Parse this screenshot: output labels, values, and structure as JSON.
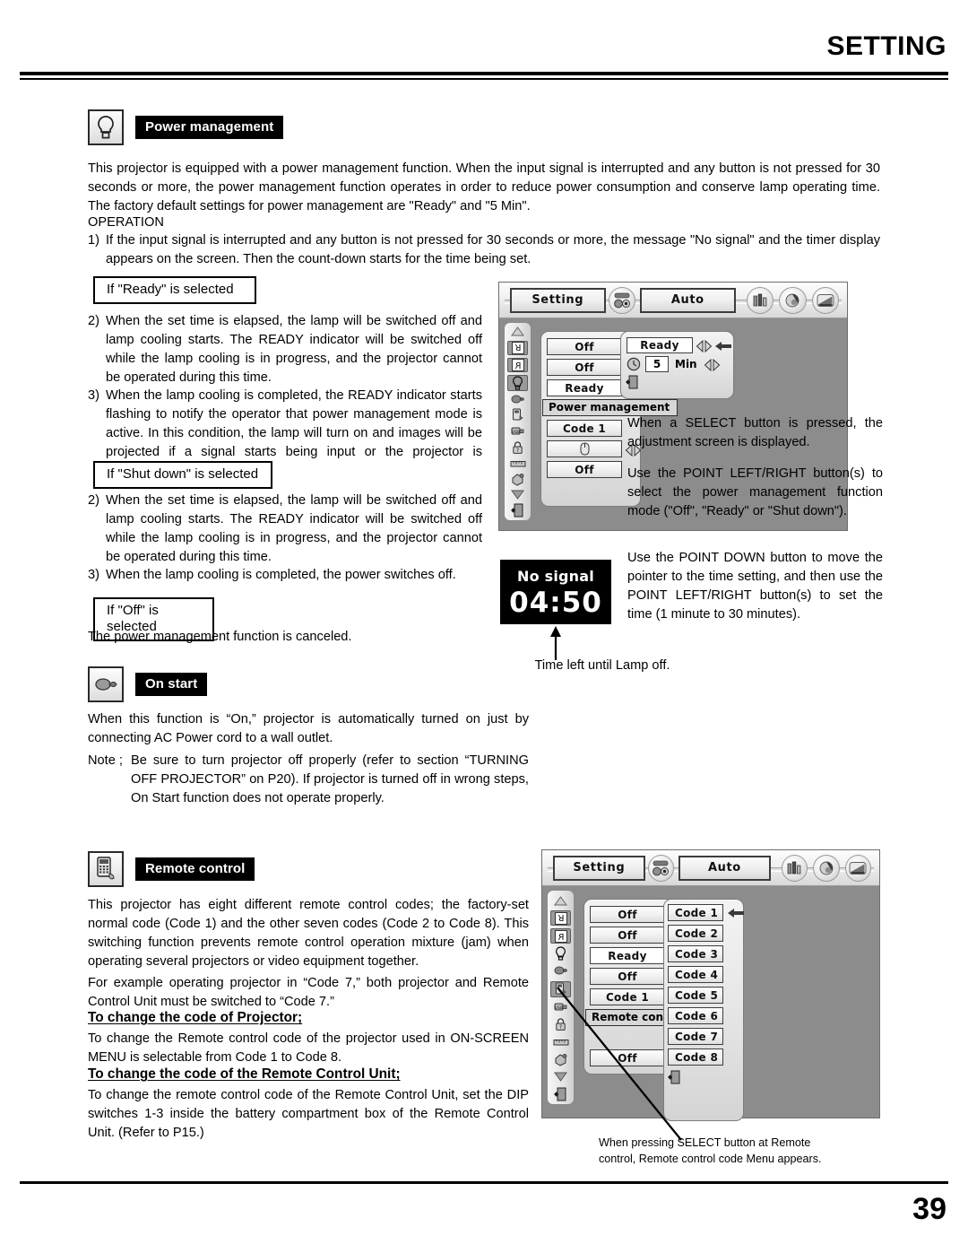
{
  "header": {
    "title": "SETTING"
  },
  "footer": {
    "page_number": "39"
  },
  "sections": {
    "power_management": {
      "icon_name": "lamp-icon",
      "label": "Power management",
      "intro": "This projector is equipped with a power management function. When the input signal is interrupted and any button is not pressed for 30 seconds or more, the power management function operates in order to reduce power consumption and conserve lamp operating time. The factory default settings for power management are \"Ready\" and \"5 Min\".",
      "operation_heading": "OPERATION",
      "step1_marker": "1)",
      "step1": "If the input signal is interrupted and any button is not pressed for 30 seconds or more, the message \"No signal\" and the timer display appears on the screen. Then the count-down starts for the time being set.",
      "ready_box": "If \"Ready\" is selected",
      "ready_step2_marker": "2)",
      "ready_step2": "When the set time is elapsed, the lamp will be switched off and lamp cooling starts. The READY indicator will be switched off while the lamp cooling is in progress, and the projector cannot be operated during this time.",
      "ready_step3_marker": "3)",
      "ready_step3": "When the lamp cooling is completed, the READY indicator starts flashing to notify the operator that power management mode is active. In this condition, the lamp will turn on and images will be projected if a signal starts being input or the projector is operated.",
      "shutdown_box": "If \"Shut down\" is selected",
      "shutdown_step2_marker": "2)",
      "shutdown_step2": "When the set time is elapsed, the lamp will be switched off and lamp cooling starts. The READY indicator will be switched off while the lamp cooling is in progress, and the projector cannot be operated during this time.",
      "shutdown_step3_marker": "3)",
      "shutdown_step3": "When the lamp cooling is completed, the power switches off.",
      "off_box": "If \"Off\" is selected",
      "off_text": "The power management function is canceled."
    },
    "on_start": {
      "icon_name": "on-start-icon",
      "label": "On start",
      "body": "When this function is “On,” projector is automatically turned on just by connecting AC Power cord to a wall outlet.",
      "note_marker": "Note ;",
      "note": "Be sure to turn projector off properly (refer to section “TURNING OFF PROJECTOR” on P20).  If projector is turned off in wrong steps, On Start function does not operate properly."
    },
    "remote_control": {
      "icon_name": "remote-control-icon",
      "label": "Remote control",
      "body1": "This projector has eight different remote control codes; the factory-set normal code (Code 1) and the other seven codes (Code 2 to Code 8).  This switching function prevents remote control operation mixture (jam) when operating several projectors or video equipment together.",
      "body2": "For example operating projector in “Code 7,”  both projector and Remote Control Unit must be switched to “Code 7.”",
      "head1": "To change the code of Projector;",
      "body3": "To change the Remote control code of the projector used in ON-SCREEN MENU is selectable from Code 1 to Code 8.",
      "head2": "To change the code of the Remote Control Unit;",
      "body4": "To change the remote control code of the Remote Control Unit, set the DIP switches 1-3 inside the battery compartment box of the Remote Control Unit. (Refer to P15.)"
    }
  },
  "osd_power": {
    "tab_setting": "Setting",
    "tab_auto": "Auto",
    "menu_items": [
      {
        "label": "Off",
        "type": "adjust"
      },
      {
        "label": "Off",
        "type": "adjust"
      },
      {
        "label": "Ready",
        "type": "value"
      },
      {
        "label": "Code 1",
        "type": "plain"
      },
      {
        "label": "",
        "type": "mouse"
      },
      {
        "label": "Off",
        "type": "plain"
      }
    ],
    "tooltip": "Power management",
    "sub_mode": "Ready",
    "sub_time_value": "5",
    "sub_time_unit": "Min",
    "sidebar_icons": [
      "scroll-up-icon",
      "ceiling-icon",
      "rear-icon",
      "lamp-icon",
      "on-start-icon",
      "remote-control-icon",
      "usb-icon",
      "lock-icon",
      "ruler-icon",
      "lamp-counter-icon",
      "scroll-down-icon",
      "quit-icon"
    ]
  },
  "no_signal": {
    "title": "No signal",
    "timer": "04:50",
    "caption": "Time left until Lamp off."
  },
  "right_notes": {
    "note1": "When a SELECT button is pressed, the adjustment screen is displayed.",
    "note2": "Use the POINT LEFT/RIGHT button(s) to select the power management function mode (\"Off\", \"Ready\" or \"Shut down\").",
    "note3": "Use the POINT DOWN button to move the pointer to the time setting, and then use the POINT LEFT/RIGHT button(s) to set the time (1 minute to 30 minutes)."
  },
  "osd_remote": {
    "tab_setting": "Setting",
    "tab_auto": "Auto",
    "menu_items": [
      {
        "label": "Off",
        "type": "adjust"
      },
      {
        "label": "Off",
        "type": "adjust"
      },
      {
        "label": "Ready",
        "type": "value"
      },
      {
        "label": "Off",
        "type": "adjust"
      },
      {
        "label": "Code 1",
        "type": "plain"
      },
      {
        "label": "",
        "type": "mouse"
      },
      {
        "label": "Off",
        "type": "plain"
      }
    ],
    "tooltip": "Remote control",
    "codes": [
      "Code 1",
      "Code 2",
      "Code 3",
      "Code 4",
      "Code 5",
      "Code 6",
      "Code 7",
      "Code 8"
    ],
    "selected_code": "Code 1",
    "caption": "When pressing SELECT button at Remote control, Remote control code Menu appears."
  },
  "colors": {
    "ink": "#000000",
    "osd_background": "#8c8c8c",
    "osd_panel": "#e6e6e6",
    "badge_background": "#000000",
    "badge_text": "#ffffff"
  }
}
